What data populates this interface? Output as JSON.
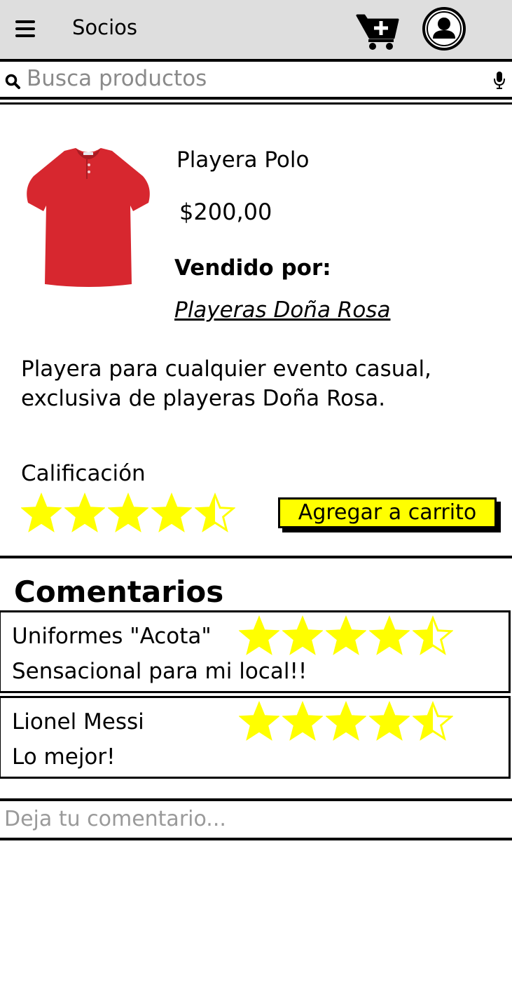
{
  "header": {
    "title": "Socios",
    "icons": {
      "menu": "menu-icon",
      "cart": "cart-add-icon",
      "profile": "user-icon"
    }
  },
  "search": {
    "placeholder": "Busca productos",
    "value": ""
  },
  "product": {
    "name": "Playera Polo",
    "price": "$200,00",
    "sold_by_label": "Vendido por:",
    "seller": "Playeras Doña Rosa",
    "description": "Playera para cualquier evento casual, exclusiva de playeras Doña Rosa.",
    "rating_label": "Calificación",
    "rating": 4.5,
    "shirt_color": "#d7272f"
  },
  "actions": {
    "add_to_cart": "Agregar a carrito"
  },
  "comments": {
    "title": "Comentarios",
    "items": [
      {
        "author": "Uniformes \"Acota\"",
        "text": "Sensacional para mi local!!",
        "rating": 4.5
      },
      {
        "author": "Lionel Messi",
        "text": "Lo mejor!",
        "rating": 4.5
      }
    ],
    "input_placeholder": "Deja tu comentario..."
  },
  "colors": {
    "star": "#ffff00",
    "button": "#ffff00",
    "topbar": "#dedede"
  }
}
